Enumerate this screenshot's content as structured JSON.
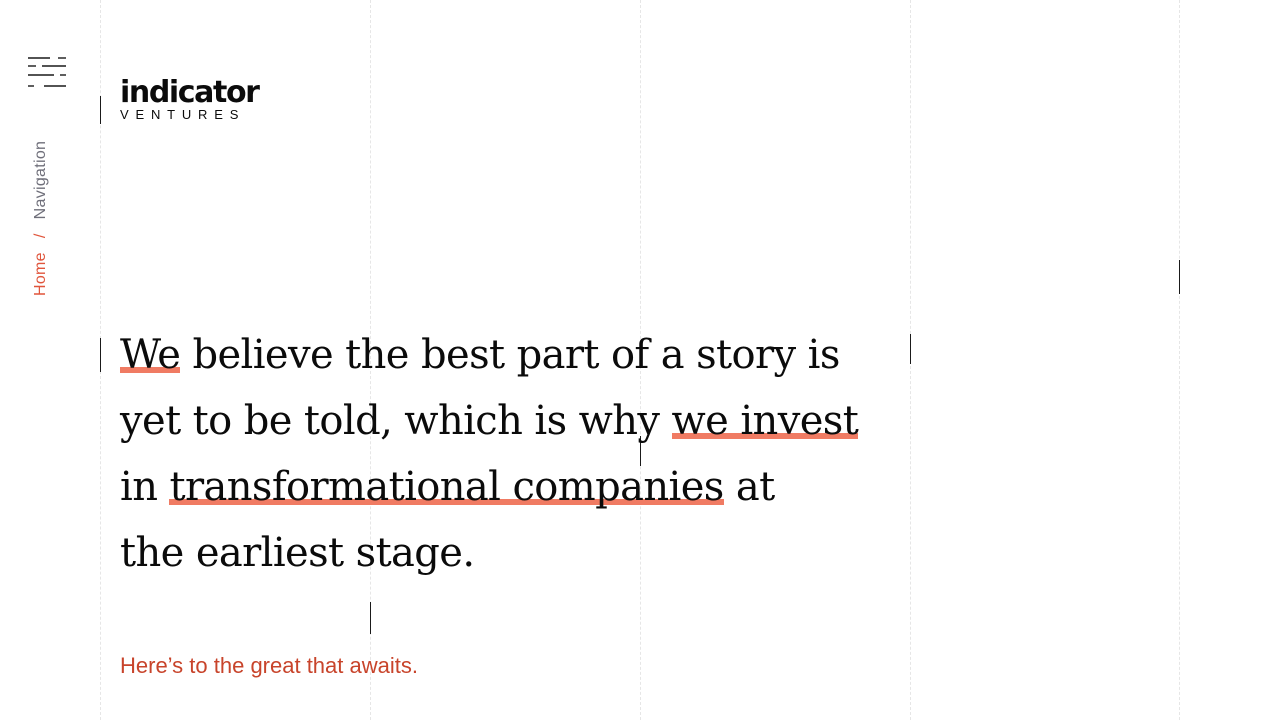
{
  "nav": {
    "menu_icon": "menu-lines-icon",
    "breadcrumb": {
      "home": "Home",
      "separator": "/",
      "current": "Navigation"
    }
  },
  "logo": {
    "word": "indicator",
    "sub": "VENTURES"
  },
  "headline": {
    "l1_link": "We",
    "l1_rest": " believe the best part of a story is",
    "l2_text": "yet to be told, which is why ",
    "l2_link": "we invest",
    "l3_pre": "in ",
    "l3_link": "transformational companies",
    "l3_post": " at",
    "l4_text": "the earliest stage."
  },
  "tagline": "Here’s to the great that awaits.",
  "colors": {
    "accent": "#e0553c",
    "underline": "#f07b63",
    "tagline": "#c8442b",
    "text": "#0b0b0b",
    "muted": "#6f6f7a"
  }
}
